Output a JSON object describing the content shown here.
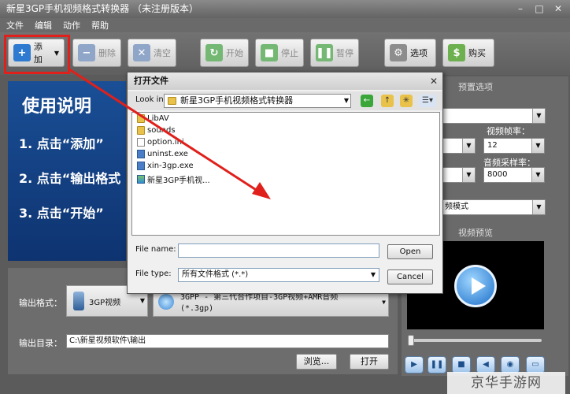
{
  "window": {
    "title": "新星3GP手机视频格式转换器 （未注册版本）"
  },
  "menu": [
    "文件",
    "编辑",
    "动作",
    "帮助"
  ],
  "toolbar": {
    "add": "添加",
    "delete": "删除",
    "clear": "清空",
    "start": "开始",
    "stop": "停止",
    "pause": "暂停",
    "options": "选项",
    "buy": "购买"
  },
  "guide": {
    "title": "使用说明",
    "steps": [
      "1. 点击“添加”",
      "2. 点击“输出格式",
      "3. 点击“开始”"
    ]
  },
  "output": {
    "format_label": "输出格式：",
    "format_value": "3GP视频",
    "format_desc_line1": "3GPP  -   第三代合作项目-3GP视频+AMR音频",
    "format_desc_line2": "(*.3gp)",
    "dir_label": "输出目录：",
    "dir_value": "C:\\新星视频软件\\输出",
    "browse": "浏览...",
    "open": "打开"
  },
  "right_panel": {
    "preset_title": "预置选项",
    "frame_rate_label": "视频帧率：",
    "frame_rate_value": "12",
    "sample_rate_label": "音频采样率：",
    "sample_rate_value": "8000",
    "mode_value": "频模式",
    "preview_title": "视频预览"
  },
  "dialog": {
    "title": "打开文件",
    "lookin_label": "Look in:",
    "lookin_value": "新星3GP手机视频格式转换器",
    "files": [
      {
        "name": "LibAV",
        "icon": "folder-icon"
      },
      {
        "name": "sounds",
        "icon": "folder-icon"
      },
      {
        "name": "option.ini",
        "icon": "ini-file-icon"
      },
      {
        "name": "uninst.exe",
        "icon": "exe-file-icon"
      },
      {
        "name": "xin-3gp.exe",
        "icon": "exe-file-icon"
      },
      {
        "name": "新星3GP手机视...",
        "icon": "app-file-icon"
      }
    ],
    "file_name_label": "File name:",
    "file_name_value": "",
    "file_type_label": "File type:",
    "file_type_value": "所有文件格式 (*.*)",
    "open": "Open",
    "cancel": "Cancel"
  },
  "watermark": "京华手游网",
  "colors": {
    "highlight": "#e0201b",
    "guide_bg": "#123f82"
  }
}
